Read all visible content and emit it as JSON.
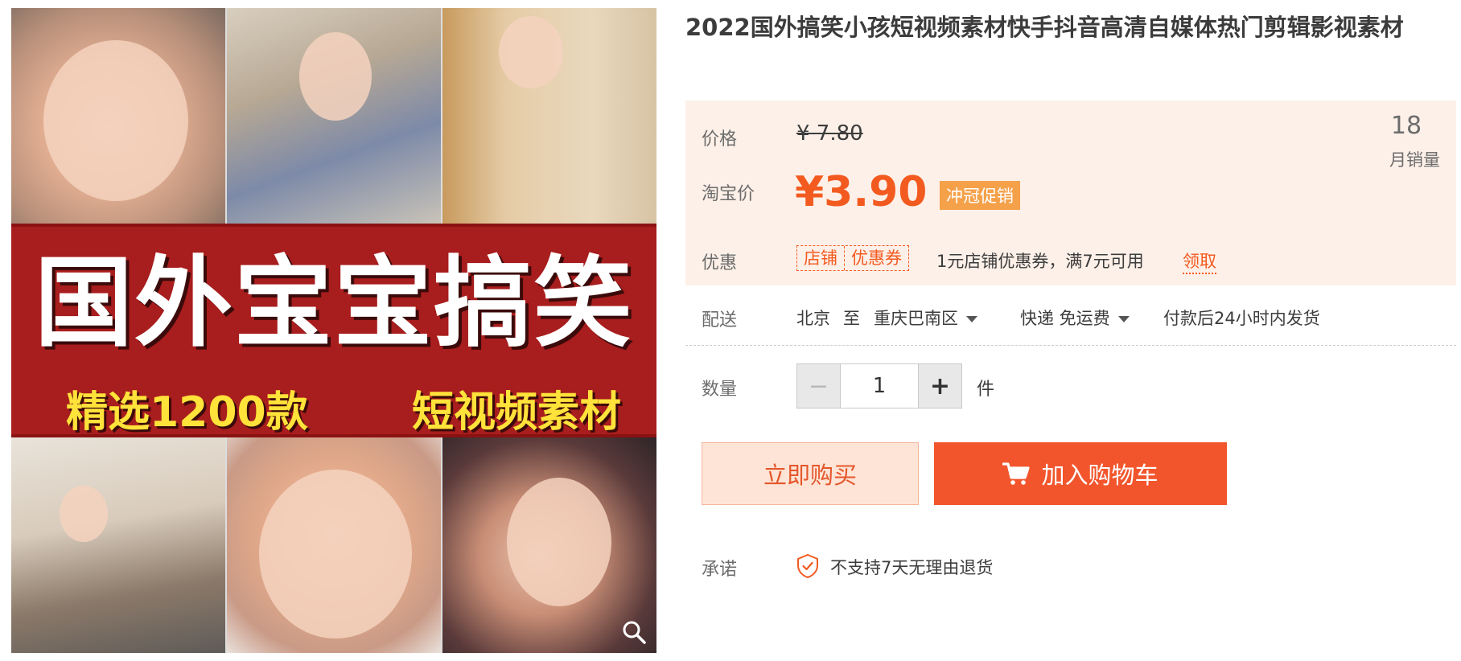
{
  "product": {
    "title": "2022国外搞笑小孩短视频素材快手抖音高清自媒体热门剪辑影视素材"
  },
  "gallery": {
    "banner_title": "国外宝宝搞笑",
    "banner_left": "精选1200款",
    "banner_right": "短视频素材",
    "zoom_icon": "zoom-icon"
  },
  "pricing": {
    "price_label": "价格",
    "original_price": "¥ 7.80",
    "taobao_label": "淘宝价",
    "current_price": "¥3.90",
    "promo_badge": "冲冠促销",
    "monthly_sales": "18",
    "monthly_sales_label": "月销量",
    "discount_label": "优惠",
    "coupon_tag_shop": "店铺",
    "coupon_tag_coupon": "优惠券",
    "coupon_desc": "1元店铺优惠券，满7元可用",
    "coupon_claim": "领取",
    "accent_color": "#f25a1f"
  },
  "shipping": {
    "label": "配送",
    "from": "北京",
    "to_word": "至",
    "destination": "重庆巴南区",
    "method": "快递 免运费",
    "dispatch": "付款后24小时内发货"
  },
  "quantity": {
    "label": "数量",
    "value": "1",
    "unit": "件",
    "minus": "−",
    "plus": "+"
  },
  "actions": {
    "buy_now": "立即购买",
    "add_to_cart": "加入购物车",
    "cart_icon": "cart-icon"
  },
  "promise": {
    "label": "承诺",
    "icon": "shield-check-icon",
    "text": "不支持7天无理由退货"
  }
}
